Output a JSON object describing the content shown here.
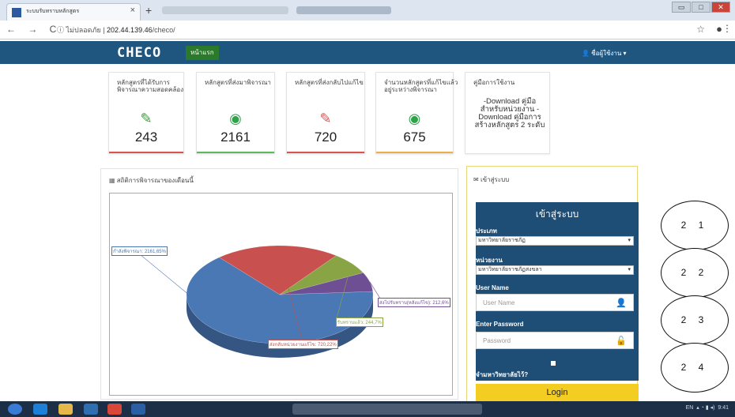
{
  "browser": {
    "tab_title": "ระบบรับทราบหลักสูตร",
    "tab_close": "×",
    "new_tab": "+",
    "nav_buttons": "← → C",
    "security": "ⓘ",
    "not_secure": "ไม่ปลอดภัย",
    "url_host": "202.44.139.46",
    "url_path": "/checo/",
    "win_min": "▭",
    "win_max": "□",
    "win_close": "✕"
  },
  "navbar": {
    "brand": "CHECO",
    "home": "หน้าแรก",
    "user_menu": "👤 ชื่อผู้ใช้งาน ▾"
  },
  "cards": [
    {
      "title": "หลักสูตรที่ได้รับการพิจารณาความสอดคล้อง",
      "icon": "✎",
      "value": "243",
      "bar_color": "#d9534f",
      "icon_color": "#3a9a3a"
    },
    {
      "title": "หลักสูตรที่ส่งมาพิจารณา",
      "icon": "◉",
      "value": "2161",
      "bar_color": "#5cb85c",
      "icon_color": "#2fa34a"
    },
    {
      "title": "หลักสูตรที่ส่งกลับไปแก้ไข",
      "icon": "✎",
      "value": "720",
      "bar_color": "#d9534f",
      "icon_color": "#d9534f"
    },
    {
      "title": "จำนวนหลักสูตรที่แก้ไขแล้วอยู่ระหว่างพิจารณา",
      "icon": "◉",
      "value": "675",
      "bar_color": "#f0ad4e",
      "icon_color": "#2fa34a"
    }
  ],
  "guide": {
    "title": "คู่มือการใช้งาน",
    "text": "-Download คู่มือสำหรับหน่วยงาน -Download คู่มือการสร้างหลักสูตร 2 ระดับ"
  },
  "stats_panel": {
    "title": "สถิติการพิจารณาของเดือนนี้",
    "icon": "▦"
  },
  "chart_data": {
    "type": "pie",
    "title": "",
    "series": [
      {
        "label": "กำลังพิจารณา: 2161,65%",
        "value": 2161,
        "percent": 65,
        "color": "#4a78b5"
      },
      {
        "label": "ส่งกลับหน่วยงานแก้ไข: 720,22%",
        "value": 720,
        "percent": 22,
        "color": "#c8504e"
      },
      {
        "label": "รับทราบแล้ว: 244,7%",
        "value": 244,
        "percent": 7,
        "color": "#88a445"
      },
      {
        "label": "ส่งไปรับทราบ(หลังแก้ไข): 212,6%",
        "value": 212,
        "percent": 6,
        "color": "#6f4f93"
      }
    ]
  },
  "login": {
    "header": "เข้าสู่ระบบ",
    "header_icon": "✉",
    "title": "เข้าสู่ระบบ",
    "type_label": "ประเภท",
    "type_value": "มหาวิทยาลัยราชภัฏ",
    "unit_label": "หน่วยงาน",
    "unit_value": "มหาวิทยาลัยราชภัฏสงขลา",
    "username_label": "User Name",
    "username_placeholder": "User Name",
    "password_label": "Enter Password",
    "password_placeholder": "Password",
    "remember_label": "จำมหาวิทยาลัยไว้?",
    "submit": "Login"
  },
  "annotations": [
    "2 1",
    "2 2",
    "2 3",
    "2 4"
  ],
  "taskbar": {
    "lang": "EN",
    "time": "9:41"
  }
}
